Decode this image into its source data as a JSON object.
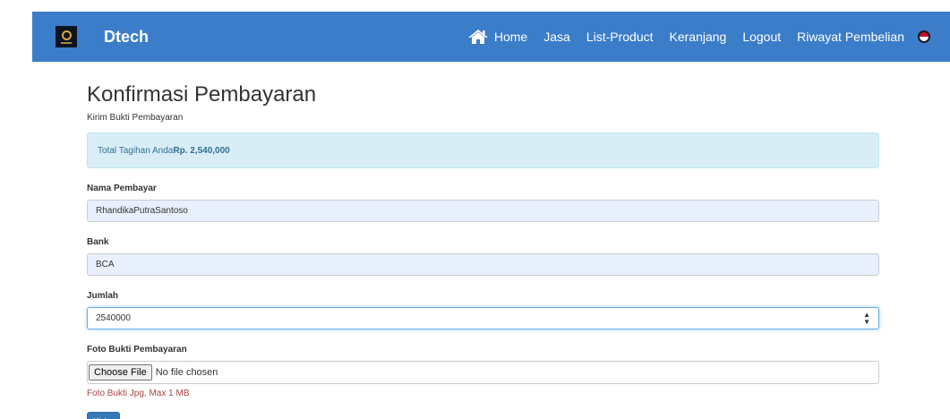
{
  "navbar": {
    "brand": "Dtech",
    "items": [
      {
        "label": "Home",
        "icon": "home-icon"
      },
      {
        "label": "Jasa"
      },
      {
        "label": "List-Product"
      },
      {
        "label": "Keranjang"
      },
      {
        "label": "Logout"
      },
      {
        "label": "Riwayat Pembelian"
      }
    ],
    "flag_icon": "flag-icon",
    "color": "#3b7dc9"
  },
  "page": {
    "title": "Konfirmasi Pembayaran",
    "subtitle": "Kirim Bukti Pembayaran"
  },
  "alert": {
    "prefix": "Total Tagihan Anda",
    "amount": "Rp. 2,540,000"
  },
  "form": {
    "nama": {
      "label": "Nama Pembayar",
      "value": "RhandikaPutraSantoso"
    },
    "bank": {
      "label": "Bank",
      "value": "BCA"
    },
    "jumlah": {
      "label": "Jumlah",
      "value": "2540000"
    },
    "foto": {
      "label": "Foto Bukti Pembayaran",
      "button": "Choose File",
      "status": "No file chosen",
      "help": "Foto Bukti Jpg, Max 1 MB"
    },
    "submit": "Kirim"
  }
}
